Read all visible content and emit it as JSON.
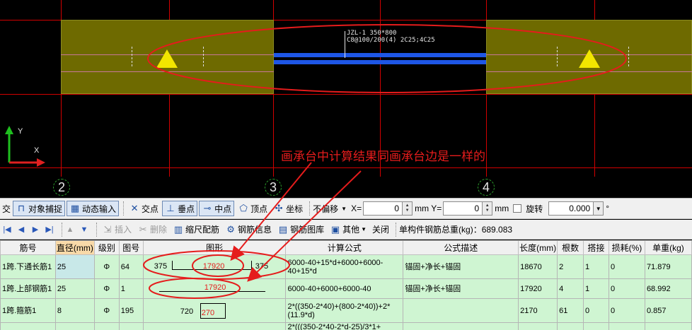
{
  "canvas": {
    "beam_label_line1": "JZL-1 350*800",
    "beam_label_line2": "C8@100/200(4) 2C25;4C25",
    "annotation": "画承台中计算结果同画承台边是一样的",
    "axis_labels": [
      "2",
      "3",
      "4"
    ],
    "ucs_x": "X",
    "ucs_y": "Y",
    "colors": {
      "background": "#000000",
      "grid": "#d20000",
      "cap": "#6e6a00",
      "beam": "#1e56e6",
      "annotation": "#e51c1c",
      "support": "#f2e600"
    }
  },
  "toolbar1": {
    "first_item": "交",
    "snap": "对象捕捉",
    "dynamic_input": "动态输入",
    "intersection": "交点",
    "perpendicular": "垂点",
    "midpoint": "中点",
    "vertex": "顶点",
    "coordinate": "坐标",
    "offset_mode": "不偏移",
    "x_label": "X=",
    "x_value": "0",
    "y_label": "mm Y=",
    "y_value": "0",
    "mm_suffix": "mm",
    "rotate_label": "旋转",
    "rotate_value": "0.000",
    "degree": "°"
  },
  "toolbar2": {
    "insert": "插入",
    "delete": "删除",
    "scale_rebar": "缩尺配筋",
    "rebar_info": "钢筋信息",
    "rebar_library": "钢筋图库",
    "other": "其他",
    "close": "关闭",
    "total_weight": "单构件钢筋总重(kg)：689.083"
  },
  "table": {
    "columns": [
      "筋号",
      "直径(mm)",
      "级别",
      "图号",
      "图形",
      "计算公式",
      "公式描述",
      "长度(mm)",
      "根数",
      "搭接",
      "损耗(%)",
      "单重(kg)"
    ],
    "rows": [
      {
        "name": "1跨.下通长筋1",
        "diameter": "25",
        "grade": "Φ",
        "fig": "64",
        "shape_left": "375",
        "shape_mid": "17920",
        "shape_right": "375",
        "formula": "6000-40+15*d+6000+6000-40+15*d",
        "desc": "锚固+净长+锚固",
        "length": "18670",
        "count": "2",
        "lap": "1",
        "loss": "0",
        "weight": "71.879"
      },
      {
        "name": "1跨.上部钢筋1",
        "diameter": "25",
        "grade": "Φ",
        "fig": "1",
        "shape_left": "",
        "shape_mid": "17920",
        "shape_right": "",
        "formula": "6000-40+6000+6000-40",
        "desc": "锚固+净长+锚固",
        "length": "17920",
        "count": "4",
        "lap": "1",
        "loss": "0",
        "weight": "68.992"
      },
      {
        "name": "1跨.箍筋1",
        "diameter": "8",
        "grade": "Φ",
        "fig": "195",
        "shape_left": "720",
        "shape_mid": "270",
        "shape_right": "",
        "formula": "2*((350-2*40)+(800-2*40))+2*(11.9*d)",
        "desc": "",
        "length": "2170",
        "count": "61",
        "lap": "0",
        "loss": "0",
        "weight": "0.857"
      },
      {
        "name": "",
        "diameter": "",
        "grade": "",
        "fig": "",
        "shape_left": "",
        "shape_mid": "",
        "shape_right": "",
        "formula": "2*(((350-2*40-2*d-25)/3*1+",
        "desc": "",
        "length": "",
        "count": "",
        "lap": "",
        "loss": "",
        "weight": ""
      }
    ]
  }
}
